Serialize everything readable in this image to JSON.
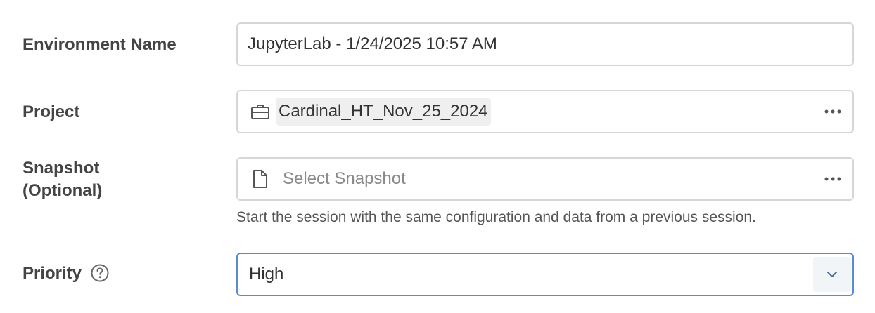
{
  "environment_name": {
    "label": "Environment Name",
    "value": "JupyterLab - 1/24/2025 10:57 AM"
  },
  "project": {
    "label": "Project",
    "value": "Cardinal_HT_Nov_25_2024",
    "icon": "briefcase-icon",
    "more_icon": "ellipsis-icon"
  },
  "snapshot": {
    "label_line1": "Snapshot",
    "label_line2": "(Optional)",
    "placeholder": "Select Snapshot",
    "icon": "document-icon",
    "more_icon": "ellipsis-icon",
    "help_text": "Start the session with the same configuration and data from a previous session."
  },
  "priority": {
    "label": "Priority",
    "value": "High",
    "help_icon": "question-circle-icon",
    "caret_icon": "chevron-down-icon"
  },
  "colors": {
    "focus_border": "#5b8ad0",
    "border": "#d6d6d6",
    "chip_bg": "#efefef",
    "caret_bg": "#f2f5f8"
  }
}
